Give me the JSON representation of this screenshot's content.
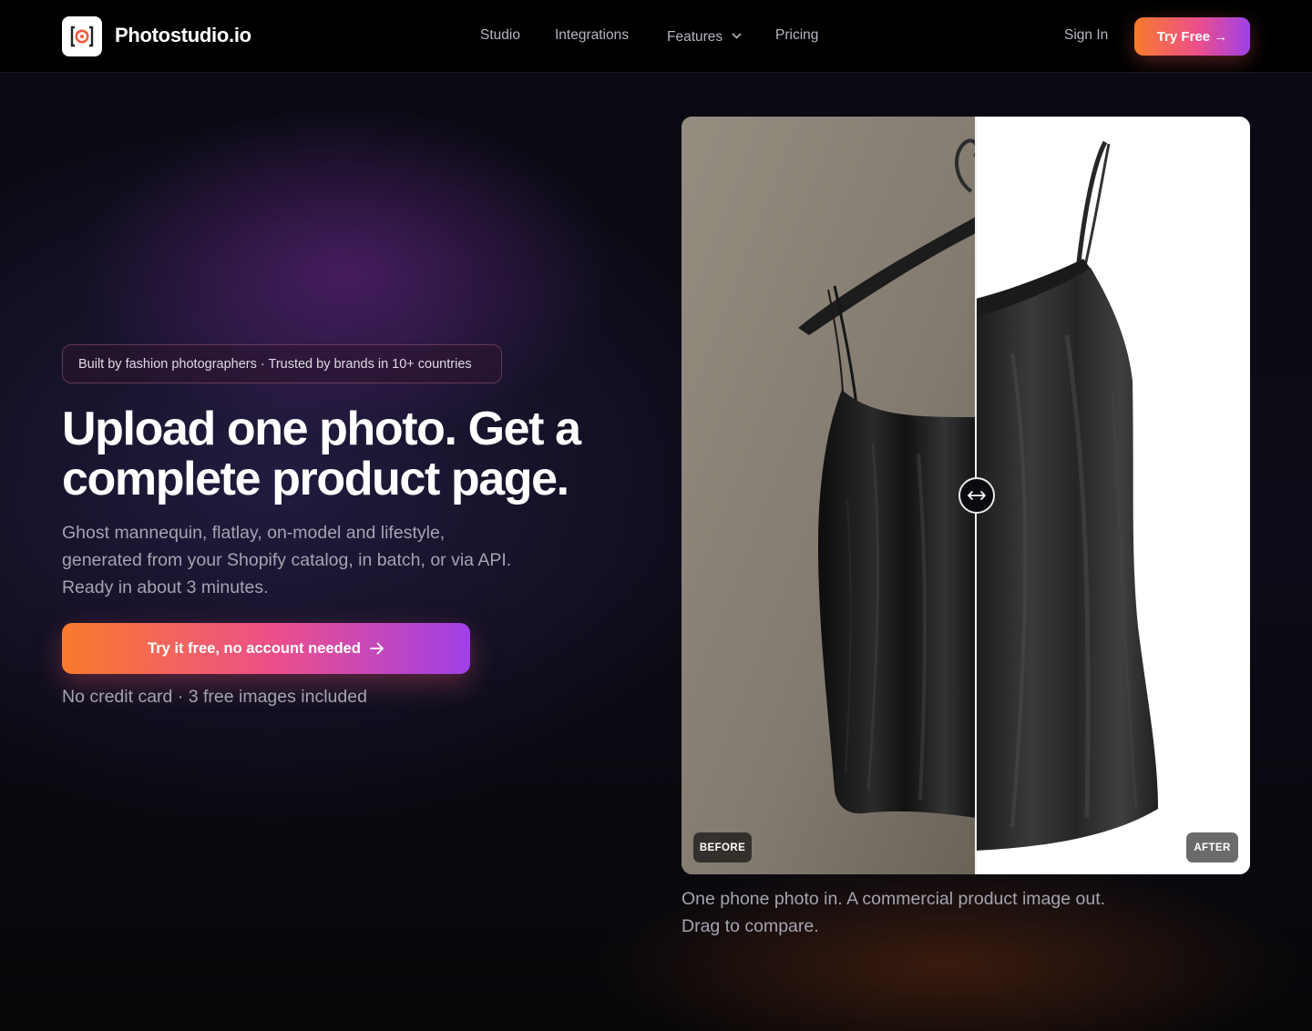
{
  "nav": {
    "brand": "Photostudio.io",
    "logo_icon": "camera-frame-icon",
    "links": [
      {
        "label": "Studio"
      },
      {
        "label": "Integrations"
      },
      {
        "label": "Features",
        "icon": "chevron-down-icon"
      },
      {
        "label": "Pricing"
      }
    ],
    "sign_in": "Sign In",
    "try_free": "Try Free →"
  },
  "hero": {
    "badge": "Built by fashion photographers · Trusted by brands in 10+ countries",
    "headline": [
      "Upload one photo. Get a",
      "complete product page."
    ],
    "subtext": [
      "Ghost mannequin, flatlay, on-model and lifestyle,",
      "generated from your Shopify catalog, in batch, or via API.",
      "Ready in about 3 minutes."
    ],
    "cta": "Try it free, no account needed",
    "cta_icon": "arrow-right-icon",
    "note": "No credit card · 3 free images included"
  },
  "compare": {
    "before_label": "BEFORE",
    "after_label": "AFTER",
    "handle_icon": "horizontal-arrows-icon",
    "caption": [
      "One phone photo in. A commercial product image out.",
      "Drag to compare."
    ]
  },
  "colors": {
    "accent_start": "#f97b2c",
    "accent_mid": "#ec4f8a",
    "accent_end": "#a040e8",
    "background": "#07070d"
  }
}
